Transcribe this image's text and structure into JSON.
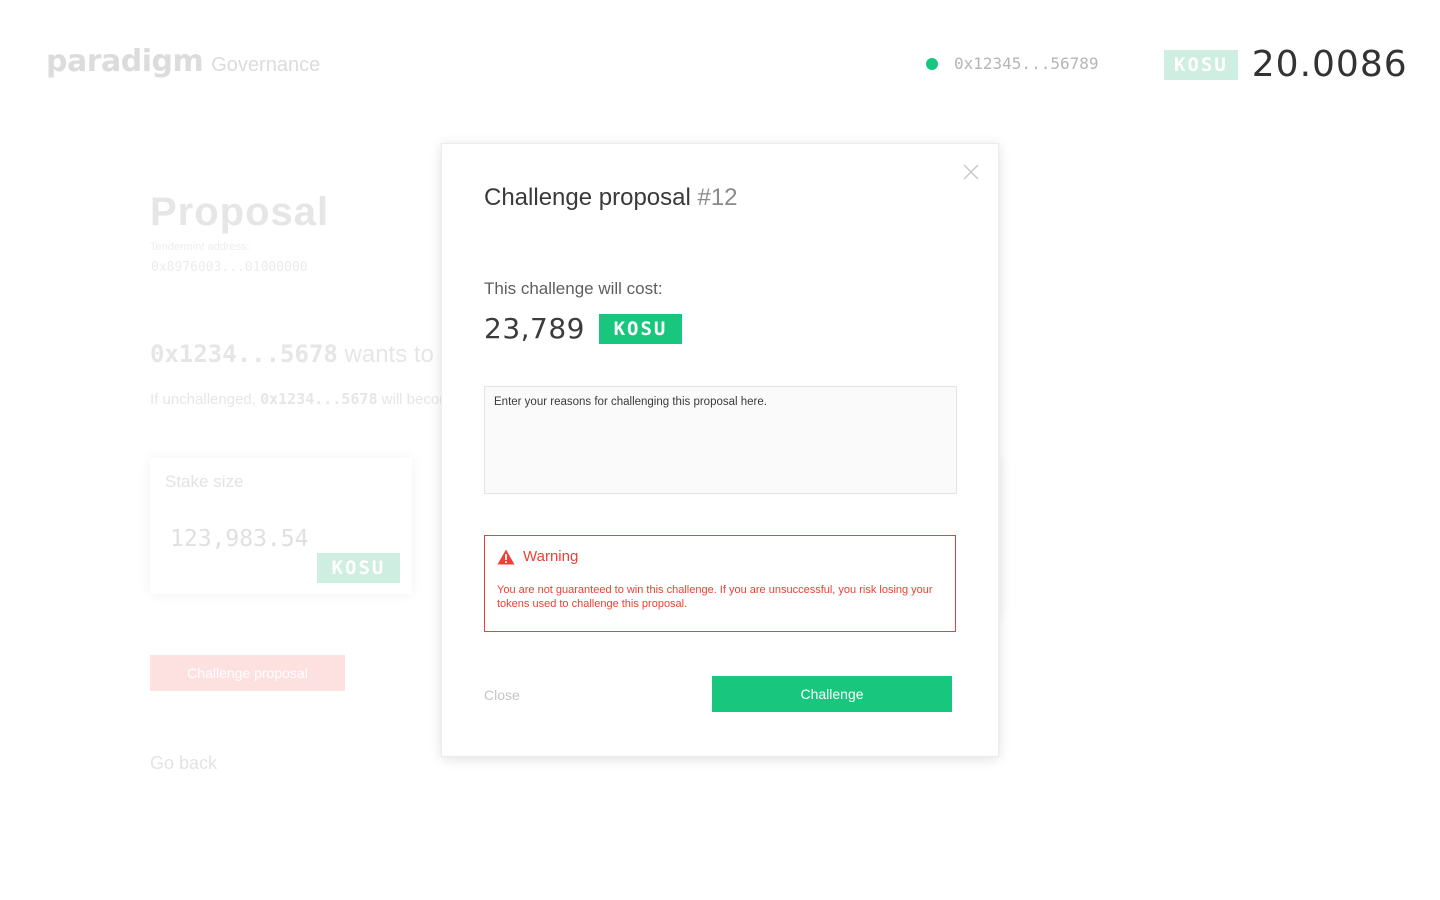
{
  "header": {
    "logo_word": "paradigm",
    "logo_sub": "Governance",
    "wallet_address": "0x12345...56789",
    "balance_token": "KOSU",
    "balance_value": "20.0086"
  },
  "background": {
    "title": "Proposal",
    "tendermint_label": "Tendermint address:",
    "tendermint_value": "0x8976003...01000000",
    "wants_addr": "0x1234...5678",
    "wants_text": " wants to be",
    "unchallenged_prefix": "If unchallenged, ",
    "unchallenged_addr": "0x1234...5678",
    "unchallenged_suffix": " will becom",
    "stake_label": "Stake size",
    "stake_value": "123,983.54",
    "stake_token": "KOSU",
    "challenge_button": "Challenge proposal",
    "go_back": "Go back"
  },
  "modal": {
    "title": "Challenge proposal ",
    "title_number": "#12",
    "cost_label": "This challenge will cost:",
    "cost_value": "23,789",
    "cost_token": "KOSU",
    "reason_placeholder": "Enter your reasons for challenging this proposal here.",
    "warning_title": "Warning",
    "warning_text": "You are not guaranteed to win this challenge. If you are unsuccessful, you risk losing your tokens used to challenge this proposal.",
    "close_label": "Close",
    "challenge_label": "Challenge"
  },
  "colors": {
    "accent_green": "#18c77d",
    "warning_red": "#ee4035"
  }
}
